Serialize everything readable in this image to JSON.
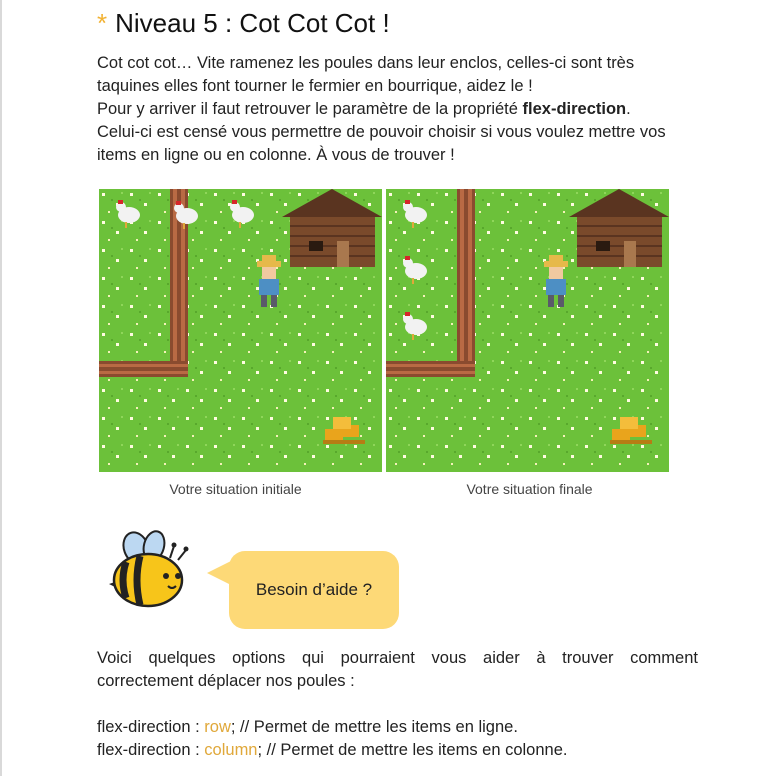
{
  "title": {
    "star": "*",
    "text": "Niveau 5 : Cot Cot Cot !"
  },
  "intro": {
    "line1": "Cot cot cot… Vite ramenez les poules dans leur enclos, celles-ci sont très taquines elles font tourner le fermier en bourrique, aidez le !",
    "line2_before": "Pour y arriver il faut retrouver le paramètre de la propriété ",
    "line2_bold": "flex-direction",
    "line2_after": ".",
    "line3": "Celui-ci est censé vous permettre de pouvoir choisir si vous voulez mettre vos items en ligne ou en colonne. À vous de trouver !"
  },
  "scenes": {
    "initial_caption": "Votre situation initiale",
    "final_caption": "Votre situation finale"
  },
  "help": {
    "bubble_label": "Besoin d’aide ?"
  },
  "options": {
    "intro_line1": "Voici quelques options qui pourraient vous aider à trouver comment",
    "intro_line2": "correctement déplacer nos poules :",
    "opt1_prefix": "flex-direction : ",
    "opt1_value": "row",
    "opt1_suffix": "; // Permet de mettre les items en ligne.",
    "opt2_prefix": "flex-direction : ",
    "opt2_value": "column",
    "opt2_suffix": "; // Permet de mettre les items en colonne."
  },
  "colors": {
    "accent": "#f2b233",
    "keyword": "#e0a83a",
    "bubble": "#fdd977",
    "grass": "#6cc13a"
  }
}
